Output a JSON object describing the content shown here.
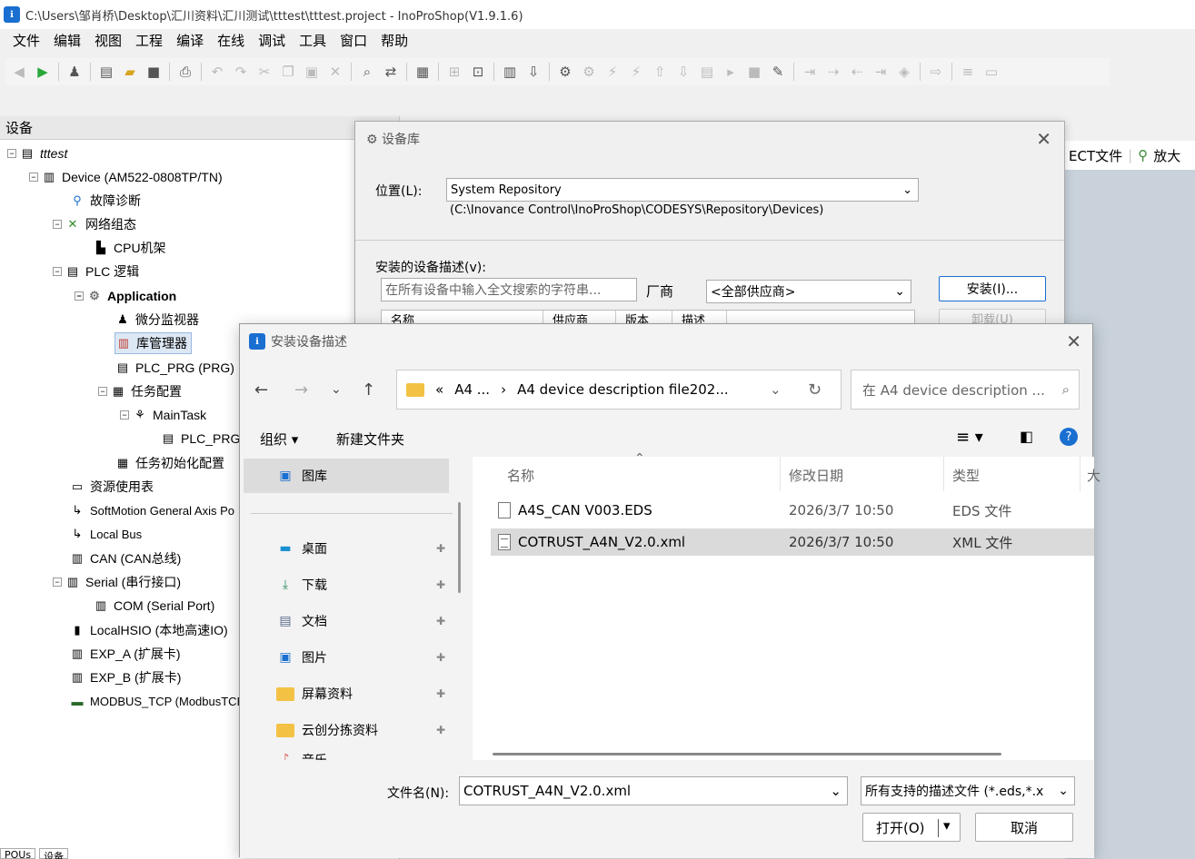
{
  "window": {
    "title": "C:\\Users\\邹肖桥\\Desktop\\汇川资料\\汇川测试\\tttest\\tttest.project - InoProShop(V1.9.1.6)"
  },
  "menu": [
    "文件",
    "编辑",
    "视图",
    "工程",
    "编译",
    "在线",
    "调试",
    "工具",
    "窗口",
    "帮助"
  ],
  "device_panel": {
    "title": "设备",
    "tree": [
      {
        "label": "tttest",
        "icon": "project-icon"
      },
      {
        "label": "Device (AM522-0808TP/TN)",
        "icon": "device-icon"
      },
      {
        "label": "故障诊断",
        "icon": "diagnosis-icon"
      },
      {
        "label": "网络组态",
        "icon": "network-icon"
      },
      {
        "label": "CPU机架",
        "icon": "rack-icon"
      },
      {
        "label": "PLC 逻辑",
        "icon": "plc-logic-icon"
      },
      {
        "label": "Application",
        "icon": "application-icon"
      },
      {
        "label": "微分监视器",
        "icon": "monitor-icon"
      },
      {
        "label": "库管理器",
        "icon": "library-icon"
      },
      {
        "label": "PLC_PRG (PRG)",
        "icon": "pou-icon"
      },
      {
        "label": "任务配置",
        "icon": "task-config-icon"
      },
      {
        "label": "MainTask",
        "icon": "task-icon"
      },
      {
        "label": "PLC_PRG",
        "icon": "pou-call-icon"
      },
      {
        "label": "任务初始化配置",
        "icon": "task-init-icon"
      },
      {
        "label": "资源使用表",
        "icon": "resource-icon"
      },
      {
        "label": "SoftMotion General Axis Po",
        "icon": "axis-icon"
      },
      {
        "label": "Local Bus",
        "icon": "bus-icon"
      },
      {
        "label": "CAN (CAN总线)",
        "icon": "can-icon"
      },
      {
        "label": "Serial (串行接口)",
        "icon": "serial-icon"
      },
      {
        "label": "COM (Serial Port)",
        "icon": "com-icon"
      },
      {
        "label": "LocalHSIO (本地高速IO)",
        "icon": "hsio-icon"
      },
      {
        "label": "EXP_A (扩展卡)",
        "icon": "exp-icon"
      },
      {
        "label": "EXP_B (扩展卡)",
        "icon": "exp-icon"
      },
      {
        "label": "MODBUS_TCP (ModbusTCP",
        "icon": "modbus-icon"
      }
    ],
    "bottom_tabs": [
      "POUs",
      "设备"
    ]
  },
  "editor_toolbar": {
    "ect_label": "ECT文件",
    "zoom_label": "放大"
  },
  "repo_dialog": {
    "title": "设备库",
    "location_label": "位置(L):",
    "location_value": "System Repository",
    "location_path": "(C:\\Inovance Control\\InoProShop\\CODESYS\\Repository\\Devices)",
    "installed_label": "安装的设备描述(v):",
    "search_placeholder": "在所有设备中输入全文搜索的字符串...",
    "vendor_label": "厂商",
    "vendor_value": "<全部供应商>",
    "install_button": "安装(I)...",
    "uninstall_button": "卸载(U)",
    "grid_columns": [
      "名称",
      "供应商",
      "版本",
      "描述"
    ]
  },
  "file_dialog": {
    "title": "安装设备描述",
    "breadcrumb": [
      "«",
      "A4 ...",
      "›",
      "A4 device description file202..."
    ],
    "search_placeholder": "在 A4 device description ...",
    "organize": "组织 ▾",
    "new_folder": "新建文件夹",
    "nav_items": [
      {
        "label": "图库",
        "icon": "gallery-icon"
      },
      {
        "label": "桌面",
        "icon": "desktop-icon"
      },
      {
        "label": "下载",
        "icon": "download-icon"
      },
      {
        "label": "文档",
        "icon": "documents-icon"
      },
      {
        "label": "图片",
        "icon": "pictures-icon"
      },
      {
        "label": "屏幕资料",
        "icon": "folder-icon"
      },
      {
        "label": "云创分拣资料",
        "icon": "folder-icon"
      },
      {
        "label": "音乐",
        "icon": "music-icon"
      }
    ],
    "columns": {
      "name": "名称",
      "date": "修改日期",
      "type": "类型",
      "size": "大"
    },
    "files": [
      {
        "name": "A4S_CAN V003.EDS",
        "date": "2026/3/7 10:50",
        "type": "EDS 文件",
        "selected": false
      },
      {
        "name": "COTRUST_A4N_V2.0.xml",
        "date": "2026/3/7 10:50",
        "type": "XML 文件",
        "selected": true
      }
    ],
    "filename_label": "文件名(N):",
    "filename_value": "COTRUST_A4N_V2.0.xml",
    "filter_value": "所有支持的描述文件 (*.eds,*.x",
    "open_button": "打开(O)",
    "cancel_button": "取消"
  },
  "colors": {
    "accent": "#1a6fd1",
    "selection": "#dadada",
    "panel_bg": "#c9d2db"
  }
}
